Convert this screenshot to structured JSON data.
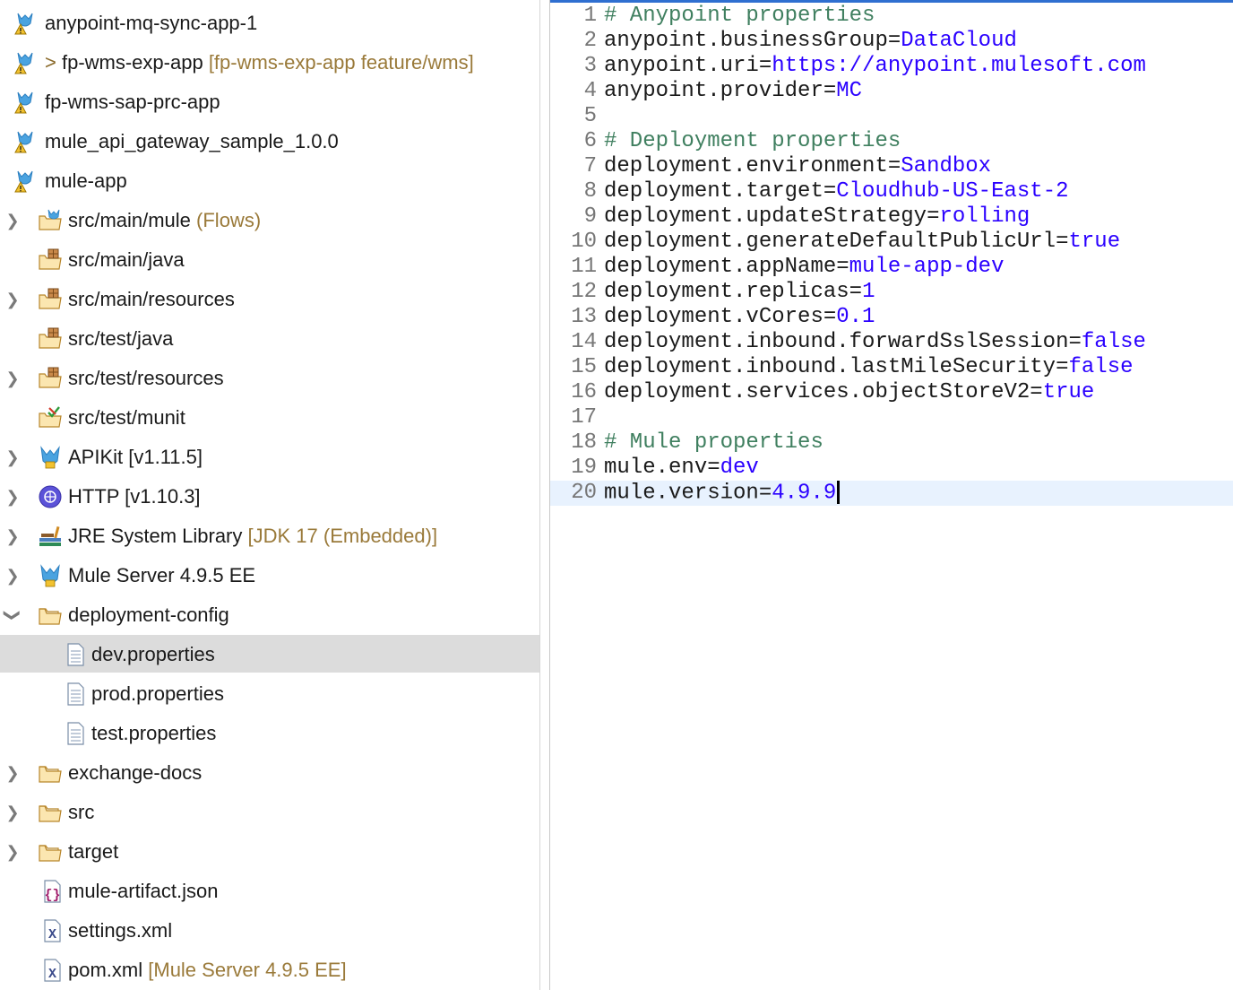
{
  "explorer": {
    "projects": [
      {
        "label": "anypoint-mq-sync-app-1",
        "prefix": "",
        "decoration": ""
      },
      {
        "label": "fp-wms-exp-app",
        "prefix": "> ",
        "decoration": "[fp-wms-exp-app feature/wms]"
      },
      {
        "label": "fp-wms-sap-prc-app",
        "prefix": "",
        "decoration": ""
      },
      {
        "label": "mule_api_gateway_sample_1.0.0",
        "prefix": "",
        "decoration": ""
      },
      {
        "label": "mule-app",
        "prefix": "",
        "decoration": ""
      }
    ],
    "children": [
      {
        "label": "src/main/mule",
        "decoration": "(Flows)"
      },
      {
        "label": "src/main/java",
        "decoration": ""
      },
      {
        "label": "src/main/resources",
        "decoration": ""
      },
      {
        "label": "src/test/java",
        "decoration": ""
      },
      {
        "label": "src/test/resources",
        "decoration": ""
      },
      {
        "label": "src/test/munit",
        "decoration": ""
      },
      {
        "label": "APIKit [v1.11.5]",
        "decoration": ""
      },
      {
        "label": "HTTP [v1.10.3]",
        "decoration": ""
      },
      {
        "label": "JRE System Library",
        "decoration": "[JDK 17 (Embedded)]"
      },
      {
        "label": "Mule Server 4.9.5 EE",
        "decoration": ""
      },
      {
        "label": "deployment-config",
        "decoration": ""
      },
      {
        "label": "dev.properties",
        "decoration": ""
      },
      {
        "label": "prod.properties",
        "decoration": ""
      },
      {
        "label": "test.properties",
        "decoration": ""
      },
      {
        "label": "exchange-docs",
        "decoration": ""
      },
      {
        "label": "src",
        "decoration": ""
      },
      {
        "label": "target",
        "decoration": ""
      },
      {
        "label": "mule-artifact.json",
        "decoration": ""
      },
      {
        "label": "settings.xml",
        "decoration": ""
      },
      {
        "label": "pom.xml",
        "decoration": "[Mule Server 4.9.5 EE]"
      }
    ]
  },
  "editor": {
    "lines": [
      {
        "n": "1",
        "comment": "# Anypoint properties",
        "key": "",
        "eq": "",
        "val": ""
      },
      {
        "n": "2",
        "comment": "",
        "key": "anypoint.businessGroup",
        "eq": "=",
        "val": "DataCloud"
      },
      {
        "n": "3",
        "comment": "",
        "key": "anypoint.uri",
        "eq": "=",
        "val": "https://anypoint.mulesoft.com"
      },
      {
        "n": "4",
        "comment": "",
        "key": "anypoint.provider",
        "eq": "=",
        "val": "MC"
      },
      {
        "n": "5",
        "comment": "",
        "key": "",
        "eq": "",
        "val": ""
      },
      {
        "n": "6",
        "comment": "# Deployment properties",
        "key": "",
        "eq": "",
        "val": ""
      },
      {
        "n": "7",
        "comment": "",
        "key": "deployment.environment",
        "eq": "=",
        "val": "Sandbox"
      },
      {
        "n": "8",
        "comment": "",
        "key": "deployment.target",
        "eq": "=",
        "val": "Cloudhub-US-East-2"
      },
      {
        "n": "9",
        "comment": "",
        "key": "deployment.updateStrategy",
        "eq": "=",
        "val": "rolling"
      },
      {
        "n": "10",
        "comment": "",
        "key": "deployment.generateDefaultPublicUrl",
        "eq": "=",
        "val": "true"
      },
      {
        "n": "11",
        "comment": "",
        "key": "deployment.appName",
        "eq": "=",
        "val": "mule-app-dev"
      },
      {
        "n": "12",
        "comment": "",
        "key": "deployment.replicas",
        "eq": "=",
        "val": "1"
      },
      {
        "n": "13",
        "comment": "",
        "key": "deployment.vCores",
        "eq": "=",
        "val": "0.1"
      },
      {
        "n": "14",
        "comment": "",
        "key": "deployment.inbound.forwardSslSession",
        "eq": "=",
        "val": "false"
      },
      {
        "n": "15",
        "comment": "",
        "key": "deployment.inbound.lastMileSecurity",
        "eq": "=",
        "val": "false"
      },
      {
        "n": "16",
        "comment": "",
        "key": "deployment.services.objectStoreV2",
        "eq": "=",
        "val": "true"
      },
      {
        "n": "17",
        "comment": "",
        "key": "",
        "eq": "",
        "val": ""
      },
      {
        "n": "18",
        "comment": "# Mule properties",
        "key": "",
        "eq": "",
        "val": ""
      },
      {
        "n": "19",
        "comment": "",
        "key": "mule.env",
        "eq": "=",
        "val": "dev"
      },
      {
        "n": "20",
        "comment": "",
        "key": "mule.version",
        "eq": "=",
        "val": "4.9.9"
      }
    ]
  },
  "colors": {
    "comment": "#3f7f5f",
    "value": "#2a00ff",
    "decoration": "#9a7a3a",
    "selection": "#dcdcdc",
    "current_line": "#e8f2fe"
  }
}
